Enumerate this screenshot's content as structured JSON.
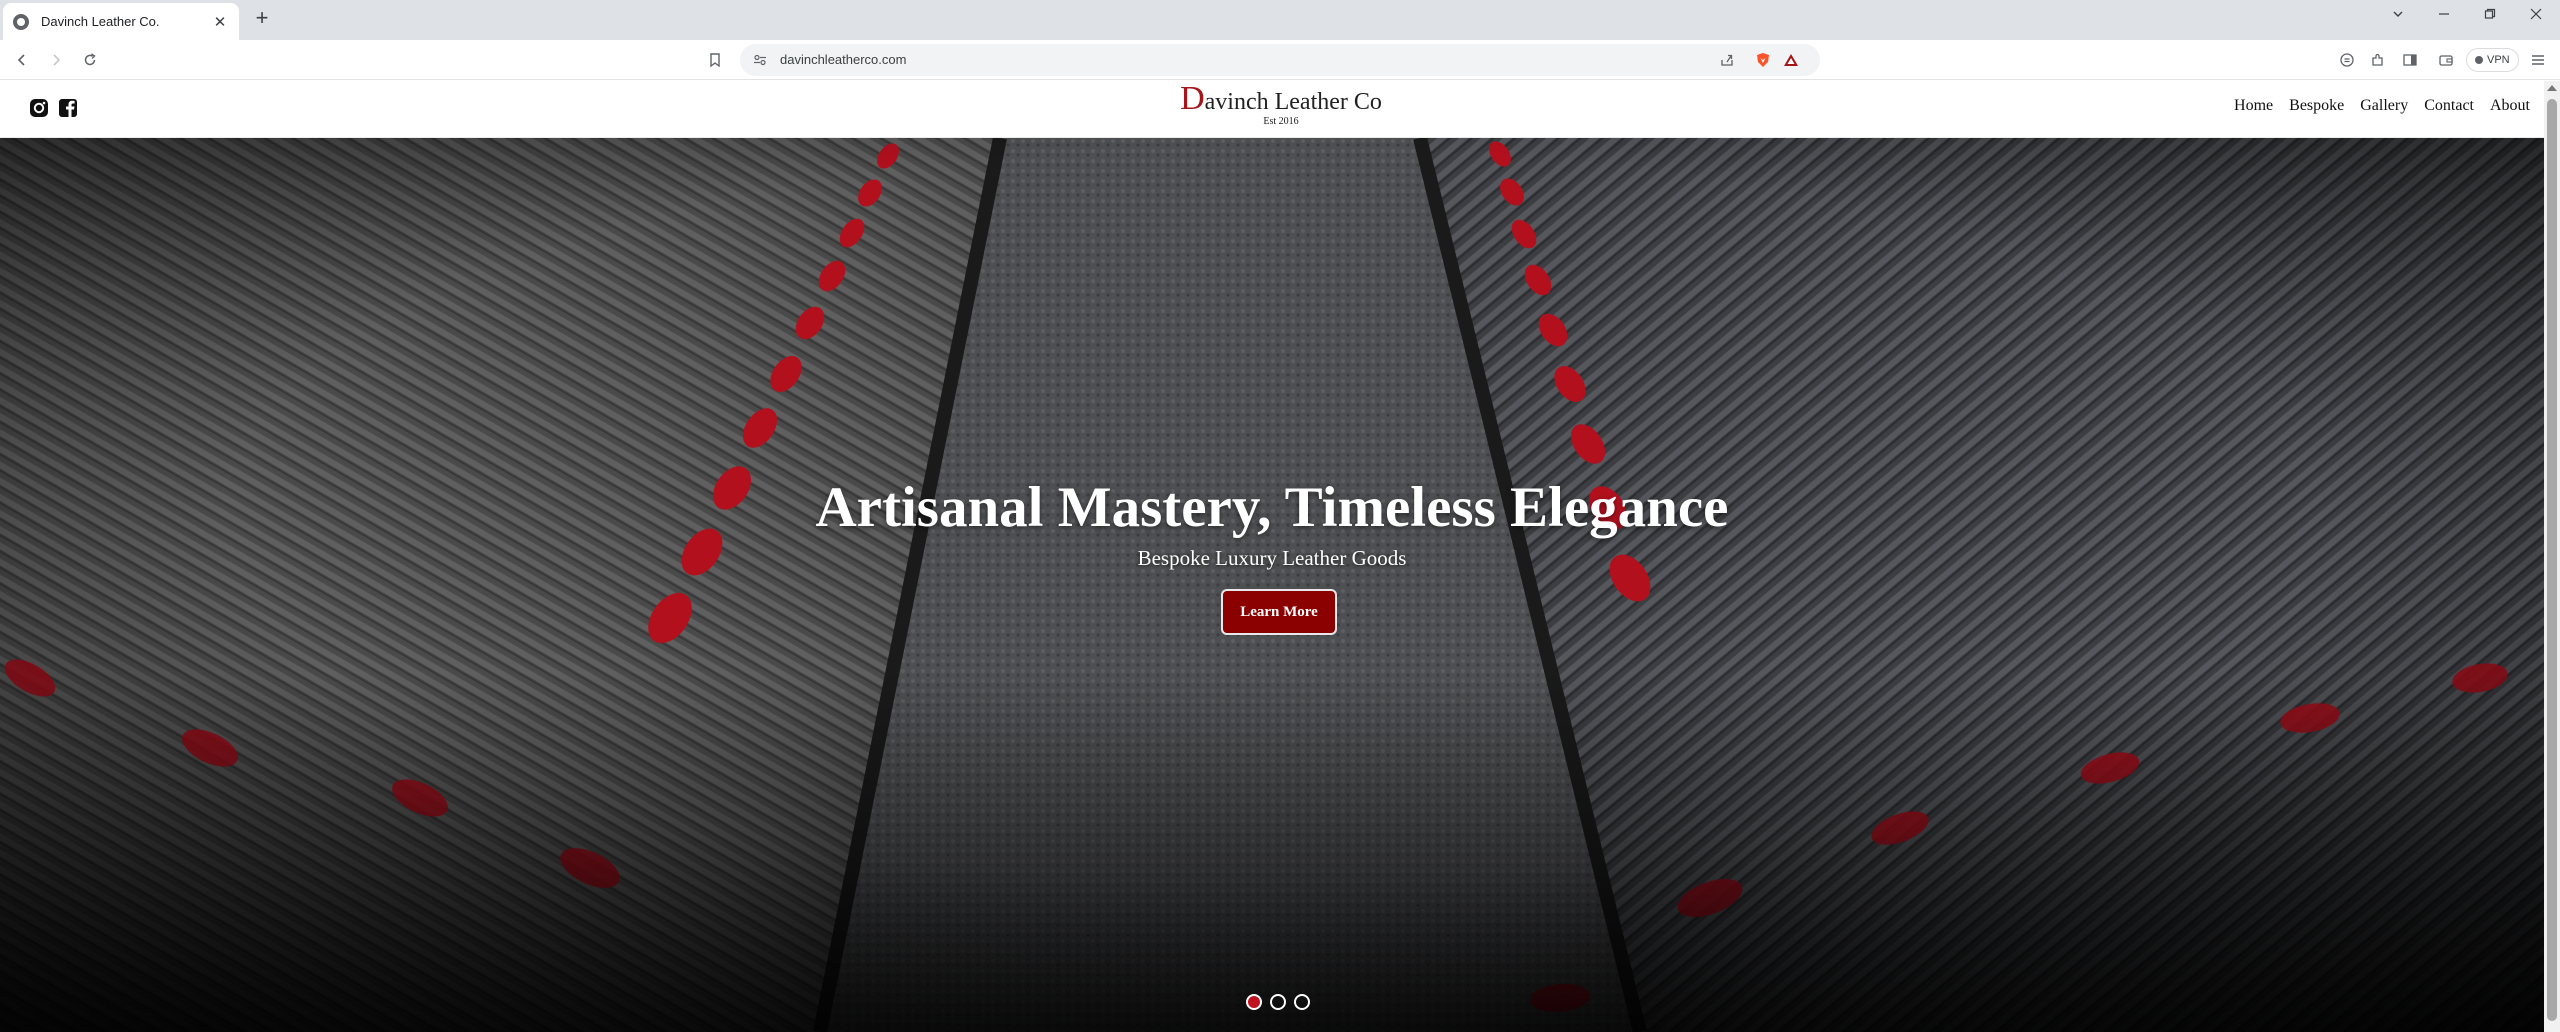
{
  "browser": {
    "tab_title": "Davinch Leather Co.",
    "new_tab": "+",
    "url": "davinchleatherco.com",
    "vpn_label": "VPN"
  },
  "site": {
    "brand_initial": "D",
    "brand_rest": "avinch Leather Co",
    "est": "Est 2016",
    "nav": [
      "Home",
      "Bespoke",
      "Gallery",
      "Contact",
      "About"
    ]
  },
  "hero": {
    "title": "Artisanal Mastery, Timeless Elegance",
    "subtitle": "Bespoke Luxury Leather Goods",
    "button": "Learn More",
    "slide_count": 3,
    "active_slide": 1
  },
  "colors": {
    "accent": "#8b0000",
    "brand_red": "#a4161a",
    "stitch_red": "#c1121f"
  }
}
